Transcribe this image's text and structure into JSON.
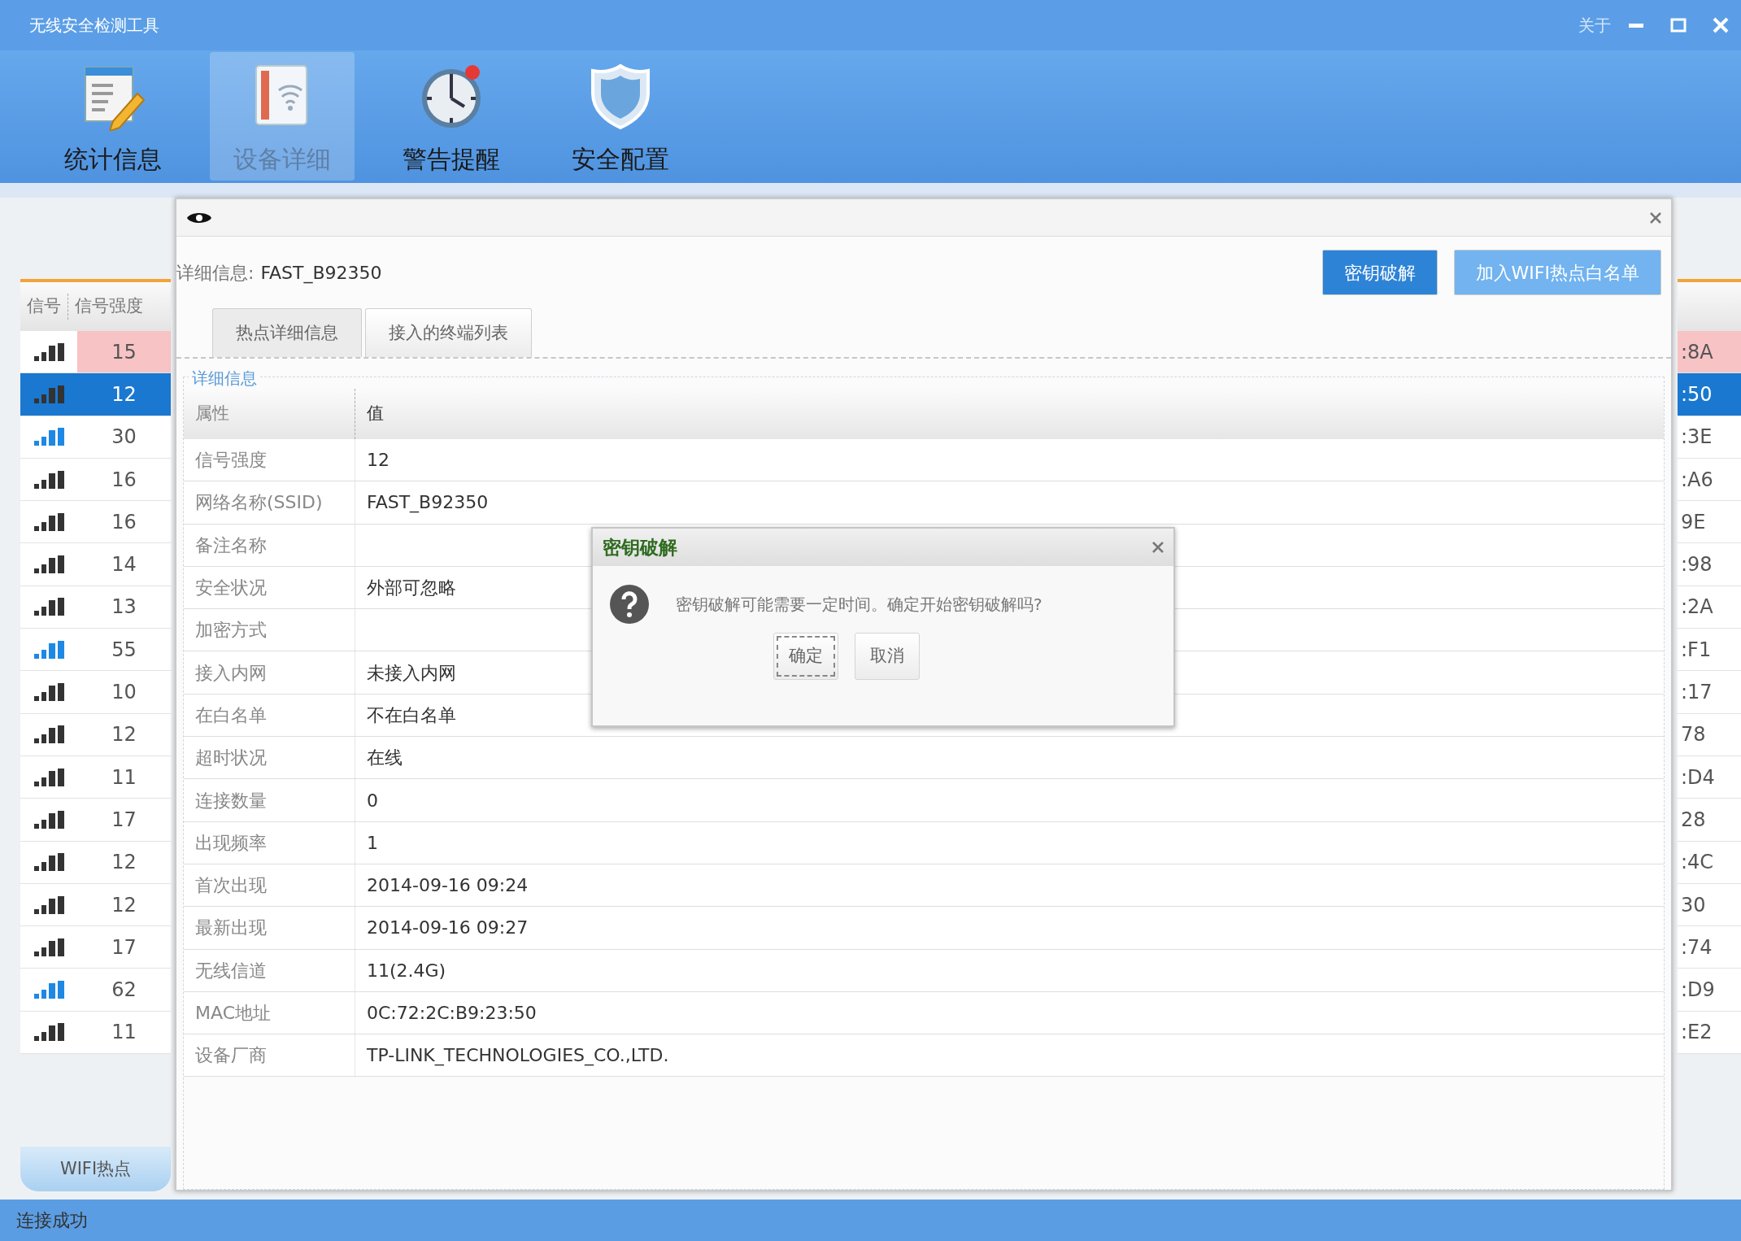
{
  "window": {
    "title": "无线安全检测工具",
    "about": "关于"
  },
  "toolbar": [
    {
      "label": "统计信息",
      "kind": "notepad",
      "selected": false
    },
    {
      "label": "设备详细",
      "kind": "wifi",
      "selected": true
    },
    {
      "label": "警告提醒",
      "kind": "clock",
      "selected": false
    },
    {
      "label": "安全配置",
      "kind": "shield",
      "selected": false
    }
  ],
  "hotspot_list": {
    "columns": [
      "信号",
      "信号强度"
    ],
    "rows": [
      {
        "strength": "15",
        "mac_tail": ":8A",
        "color": "#333333",
        "alert": true,
        "selected": false
      },
      {
        "strength": "12",
        "mac_tail": ":50",
        "color": "#333333",
        "alert": false,
        "selected": true
      },
      {
        "strength": "30",
        "mac_tail": ":3E",
        "color": "#1e88e5",
        "alert": false,
        "selected": false
      },
      {
        "strength": "16",
        "mac_tail": ":A6",
        "color": "#333333",
        "alert": false,
        "selected": false
      },
      {
        "strength": "16",
        "mac_tail": "9E",
        "color": "#333333",
        "alert": false,
        "selected": false
      },
      {
        "strength": "14",
        "mac_tail": ":98",
        "color": "#333333",
        "alert": false,
        "selected": false
      },
      {
        "strength": "13",
        "mac_tail": ":2A",
        "color": "#333333",
        "alert": false,
        "selected": false
      },
      {
        "strength": "55",
        "mac_tail": ":F1",
        "color": "#1e88e5",
        "alert": false,
        "selected": false
      },
      {
        "strength": "10",
        "mac_tail": ":17",
        "color": "#333333",
        "alert": false,
        "selected": false
      },
      {
        "strength": "12",
        "mac_tail": "78",
        "color": "#333333",
        "alert": false,
        "selected": false
      },
      {
        "strength": "11",
        "mac_tail": ":D4",
        "color": "#333333",
        "alert": false,
        "selected": false
      },
      {
        "strength": "17",
        "mac_tail": "28",
        "color": "#333333",
        "alert": false,
        "selected": false
      },
      {
        "strength": "12",
        "mac_tail": ":4C",
        "color": "#333333",
        "alert": false,
        "selected": false
      },
      {
        "strength": "12",
        "mac_tail": "30",
        "color": "#333333",
        "alert": false,
        "selected": false
      },
      {
        "strength": "17",
        "mac_tail": ":74",
        "color": "#333333",
        "alert": false,
        "selected": false
      },
      {
        "strength": "62",
        "mac_tail": ":D9",
        "color": "#1e88e5",
        "alert": false,
        "selected": false
      },
      {
        "strength": "11",
        "mac_tail": ":E2",
        "color": "#333333",
        "alert": false,
        "selected": false
      }
    ]
  },
  "bottom_tab": "WIFI热点",
  "status_bar": "连接成功",
  "detail_window": {
    "label": "详细信息:",
    "ssid": "FAST_B92350",
    "buttons": [
      {
        "label": "密钥破解",
        "kind": "primary"
      },
      {
        "label": "加入WIFI热点白名单",
        "kind": "light"
      }
    ],
    "tabs": [
      {
        "label": "热点详细信息",
        "selected": true
      },
      {
        "label": "接入的终端列表",
        "selected": false
      }
    ],
    "legend": "详细信息",
    "columns": [
      "属性",
      "值"
    ],
    "rows": [
      {
        "property": "信号强度",
        "value": "12"
      },
      {
        "property": "网络名称(SSID)",
        "value": "FAST_B92350"
      },
      {
        "property": "备注名称"
      },
      {
        "property": "安全状况",
        "value": "外部可忽略"
      },
      {
        "property": "加密方式"
      },
      {
        "property": "接入内网",
        "value": "未接入内网"
      },
      {
        "property": "在白名单",
        "value": "不在白名单"
      },
      {
        "property": "超时状况",
        "value": "在线"
      },
      {
        "property": "连接数量",
        "value": "0"
      },
      {
        "property": "出现频率",
        "value": "1"
      },
      {
        "property": "首次出现",
        "value": "2014-09-16 09:24"
      },
      {
        "property": "最新出现",
        "value": "2014-09-16 09:27"
      },
      {
        "property": "无线信道",
        "value": "11(2.4G)"
      },
      {
        "property": "MAC地址",
        "value": "0C:72:2C:B9:23:50"
      },
      {
        "property": "设备厂商",
        "value": "TP-LINK_TECHNOLOGIES_CO.,LTD."
      }
    ]
  },
  "confirm_dialog": {
    "title": "密钥破解",
    "message": "密钥破解可能需要一定时间。确定开始密钥破解吗?",
    "buttons": [
      {
        "label": "确定",
        "focused": true
      },
      {
        "label": "取消",
        "focused": false
      }
    ]
  }
}
